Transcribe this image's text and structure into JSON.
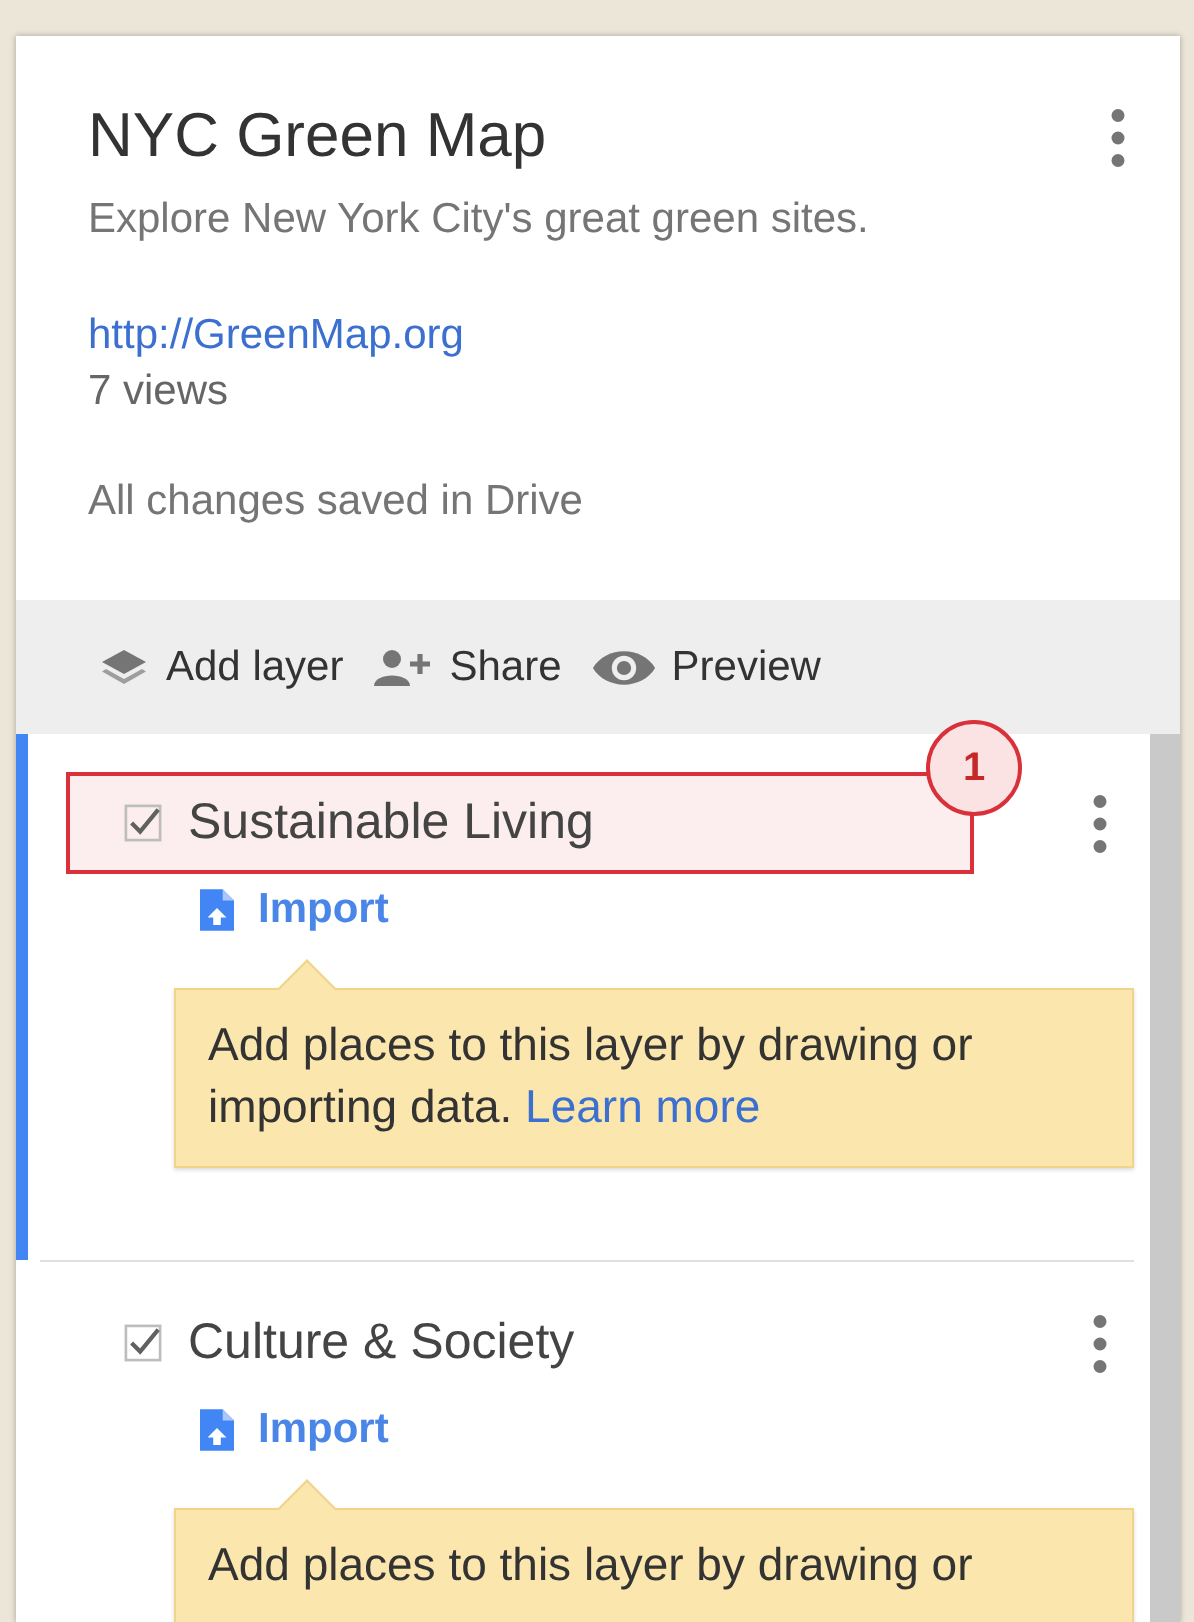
{
  "map": {
    "title": "NYC Green Map",
    "description": "Explore New York City's great green sites.",
    "link": "http://GreenMap.org",
    "views": "7 views",
    "save_status": "All changes saved in Drive"
  },
  "toolbar": [
    {
      "kind": "layers",
      "label": "Add layer"
    },
    {
      "kind": "share",
      "label": "Share"
    },
    {
      "kind": "preview",
      "label": "Preview"
    }
  ],
  "layers": [
    {
      "name": "Sustainable Living",
      "checked": true,
      "active": true,
      "highlighted": true,
      "annotation": "1",
      "import": "Import",
      "hint": {
        "text": "Add places to this layer by drawing or importing data.",
        "link": "Learn more"
      }
    },
    {
      "name": "Culture & Society",
      "checked": true,
      "active": false,
      "highlighted": false,
      "import": "Import",
      "hint": {
        "text": "Add places to this layer by drawing or"
      }
    }
  ]
}
